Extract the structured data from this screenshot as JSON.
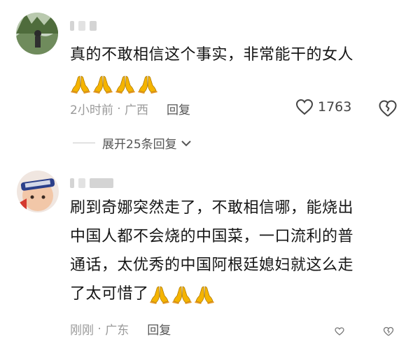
{
  "comments": [
    {
      "username": "",
      "text_lines": [
        "真的不敢相信这个事实，非常能干的女人"
      ],
      "emoji_count": 4,
      "time": "2小时前",
      "location": "广西",
      "reply_label": "回复",
      "likes": "1763",
      "expand_label": "展开25条回复"
    },
    {
      "username": "",
      "text_lines": [
        "刷到奇娜突然走了，不敢相信哪，能烧出",
        "中国人都不会烧的中国菜，一口流利的普",
        "通话，太优秀的中国阿根廷媳妇就这么走",
        "了太可惜了"
      ],
      "emoji_count": 3,
      "time": "刚刚",
      "location": "广东",
      "reply_label": "回复"
    }
  ],
  "icons": {
    "like": "heart-outline-icon",
    "dislike": "broken-heart-icon",
    "expand": "chevron-down-icon",
    "pray": "folded-hands-emoji"
  },
  "colors": {
    "text": "#151515",
    "meta": "#9a9a9a",
    "emoji": "#f5b400"
  }
}
